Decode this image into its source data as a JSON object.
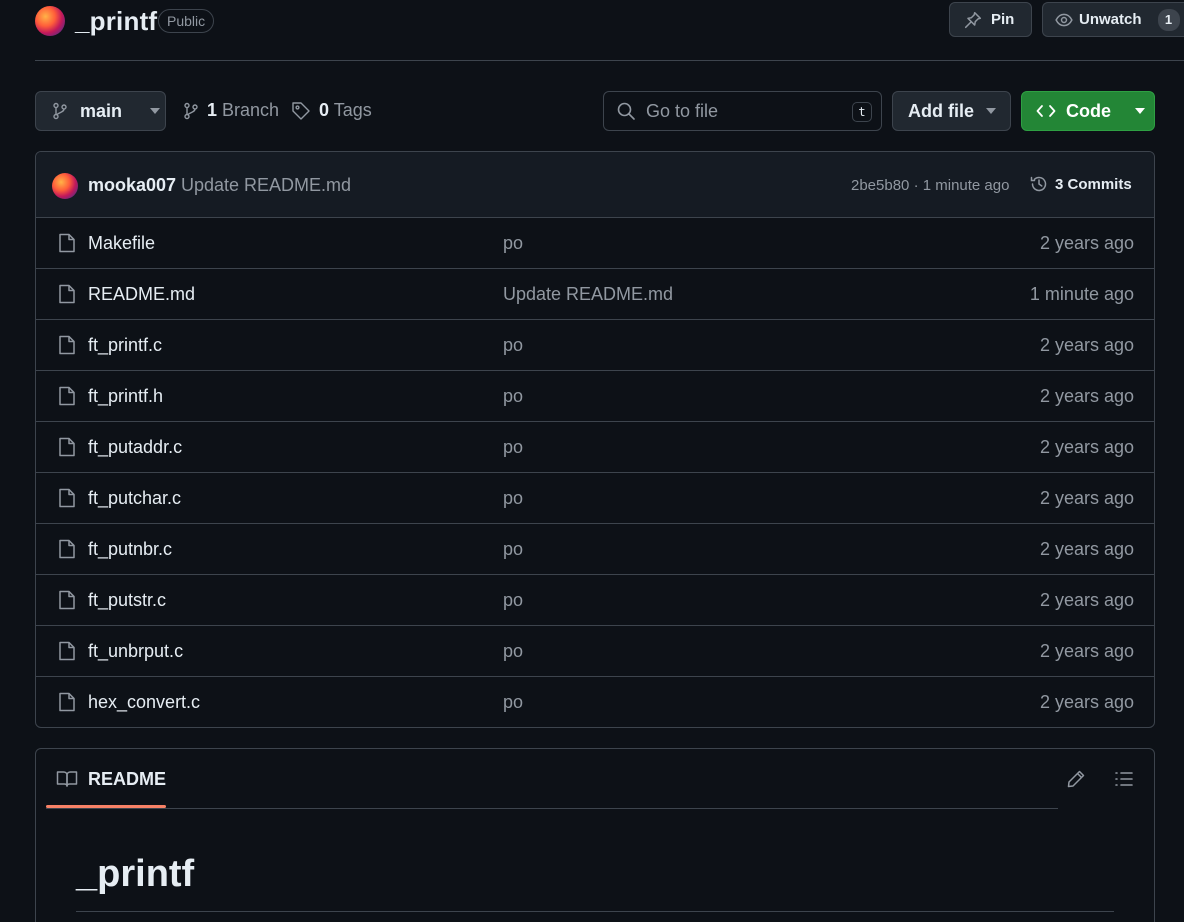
{
  "repo": {
    "name": "_printf",
    "visibility": "Public"
  },
  "header_actions": {
    "pin_label": "Pin",
    "unwatch_label": "Unwatch",
    "watch_count": "1"
  },
  "toolbar": {
    "branch": "main",
    "branch_count": "1",
    "branch_label": "Branch",
    "tag_count": "0",
    "tag_label": "Tags",
    "search_placeholder": "Go to file",
    "search_shortcut": "t",
    "add_file_label": "Add file",
    "code_label": "Code",
    "code_color": "#238636"
  },
  "latest_commit": {
    "author": "mooka007",
    "message": "Update README.md",
    "hash_and_time": "2be5b80 · 1 minute ago",
    "commits_label": "3 Commits"
  },
  "files": [
    {
      "name": "Makefile",
      "commit": "po",
      "date": "2 years ago"
    },
    {
      "name": "README.md",
      "commit": "Update README.md",
      "date": "1 minute ago"
    },
    {
      "name": "ft_printf.c",
      "commit": "po",
      "date": "2 years ago"
    },
    {
      "name": "ft_printf.h",
      "commit": "po",
      "date": "2 years ago"
    },
    {
      "name": "ft_putaddr.c",
      "commit": "po",
      "date": "2 years ago"
    },
    {
      "name": "ft_putchar.c",
      "commit": "po",
      "date": "2 years ago"
    },
    {
      "name": "ft_putnbr.c",
      "commit": "po",
      "date": "2 years ago"
    },
    {
      "name": "ft_putstr.c",
      "commit": "po",
      "date": "2 years ago"
    },
    {
      "name": "ft_unbrput.c",
      "commit": "po",
      "date": "2 years ago"
    },
    {
      "name": "hex_convert.c",
      "commit": "po",
      "date": "2 years ago"
    }
  ],
  "readme": {
    "tab_label": "README",
    "heading": "_printf",
    "accent_color": "#f78166"
  }
}
